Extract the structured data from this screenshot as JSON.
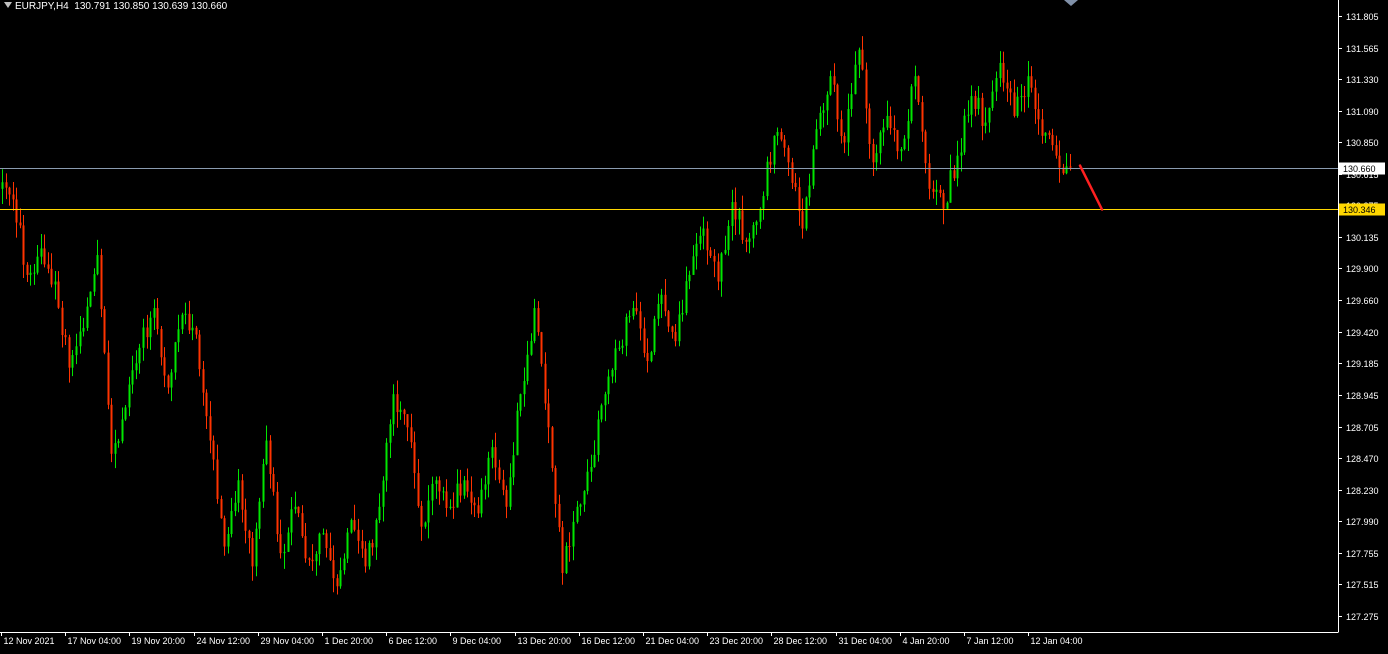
{
  "title": {
    "symbol": "EURJPY,H4",
    "ohlc": "130.791 130.850 130.639 130.660"
  },
  "colors": {
    "background": "#000000",
    "axis": "#ffffff",
    "bull": "#00e600",
    "bear": "#ff3300",
    "bid_line": "#8a9bb0",
    "level_line": "#ffd700",
    "label_bg": "#ffd700",
    "arrow": "#ff2020"
  },
  "chart_data": {
    "type": "candlestick",
    "symbol": "EURJPY",
    "timeframe": "H4",
    "ylim": [
      127.155,
      131.925
    ],
    "y_ticks": [
      "131.805",
      "131.565",
      "131.330",
      "131.090",
      "130.850",
      "130.615",
      "130.375",
      "130.135",
      "129.900",
      "129.660",
      "129.420",
      "129.185",
      "128.945",
      "128.705",
      "128.470",
      "128.230",
      "127.990",
      "127.755",
      "127.515",
      "127.275"
    ],
    "x_ticks": [
      "12 Nov 2021",
      "17 Nov 04:00",
      "19 Nov 20:00",
      "24 Nov 12:00",
      "29 Nov 04:00",
      "1 Dec 20:00",
      "6 Dec 12:00",
      "9 Dec 04:00",
      "13 Dec 20:00",
      "16 Dec 12:00",
      "21 Dec 04:00",
      "23 Dec 20:00",
      "28 Dec 12:00",
      "31 Dec 04:00",
      "4 Jan 20:00",
      "7 Jan 12:00",
      "12 Jan 04:00"
    ],
    "current_price": 130.66,
    "level": 130.346,
    "grid": false,
    "anchors": [
      [
        130.5,
        130.42
      ],
      [
        130.42,
        129.85
      ],
      [
        129.85,
        130.05
      ],
      [
        130.05,
        129.8
      ],
      [
        129.8,
        129.15
      ],
      [
        129.15,
        129.45
      ],
      [
        129.45,
        130.0
      ],
      [
        130.0,
        128.5
      ],
      [
        128.5,
        128.85
      ],
      [
        128.85,
        129.3
      ],
      [
        129.3,
        129.6
      ],
      [
        129.6,
        129.0
      ],
      [
        129.0,
        129.55
      ],
      [
        129.55,
        129.4
      ],
      [
        129.4,
        128.6
      ],
      [
        128.6,
        127.8
      ],
      [
        127.8,
        128.3
      ],
      [
        128.3,
        127.65
      ],
      [
        127.65,
        128.6
      ],
      [
        128.6,
        127.75
      ],
      [
        127.75,
        128.1
      ],
      [
        128.1,
        127.7
      ],
      [
        127.7,
        127.9
      ],
      [
        127.9,
        127.5
      ],
      [
        127.5,
        128.0
      ],
      [
        128.0,
        127.65
      ],
      [
        127.65,
        128.1
      ],
      [
        128.1,
        128.95
      ],
      [
        128.95,
        128.7
      ],
      [
        128.7,
        127.95
      ],
      [
        127.95,
        128.3
      ],
      [
        128.3,
        128.1
      ],
      [
        128.1,
        128.3
      ],
      [
        128.3,
        128.05
      ],
      [
        128.05,
        128.55
      ],
      [
        128.55,
        128.1
      ],
      [
        128.1,
        128.95
      ],
      [
        128.95,
        129.6
      ],
      [
        129.6,
        128.7
      ],
      [
        128.7,
        127.6
      ],
      [
        127.6,
        128.1
      ],
      [
        128.1,
        128.4
      ],
      [
        128.4,
        128.95
      ],
      [
        128.95,
        129.3
      ],
      [
        129.3,
        129.6
      ],
      [
        129.6,
        129.2
      ],
      [
        129.2,
        129.7
      ],
      [
        129.7,
        129.35
      ],
      [
        129.35,
        129.85
      ],
      [
        129.85,
        130.2
      ],
      [
        130.2,
        129.8
      ],
      [
        129.8,
        130.4
      ],
      [
        130.4,
        130.1
      ],
      [
        130.1,
        130.35
      ],
      [
        130.35,
        130.9
      ],
      [
        130.9,
        130.7
      ],
      [
        130.7,
        130.2
      ],
      [
        130.2,
        130.95
      ],
      [
        130.95,
        131.35
      ],
      [
        131.35,
        130.85
      ],
      [
        130.85,
        131.55
      ],
      [
        131.55,
        130.7
      ],
      [
        130.7,
        131.05
      ],
      [
        131.05,
        130.8
      ],
      [
        130.8,
        131.35
      ],
      [
        131.35,
        130.5
      ],
      [
        130.5,
        130.35
      ],
      [
        130.35,
        130.75
      ],
      [
        130.75,
        131.2
      ],
      [
        131.2,
        131.0
      ],
      [
        131.0,
        131.45
      ],
      [
        131.45,
        131.05
      ],
      [
        131.05,
        131.35
      ],
      [
        131.35,
        130.9
      ],
      [
        130.9,
        130.75
      ],
      [
        130.75,
        130.66
      ]
    ]
  }
}
